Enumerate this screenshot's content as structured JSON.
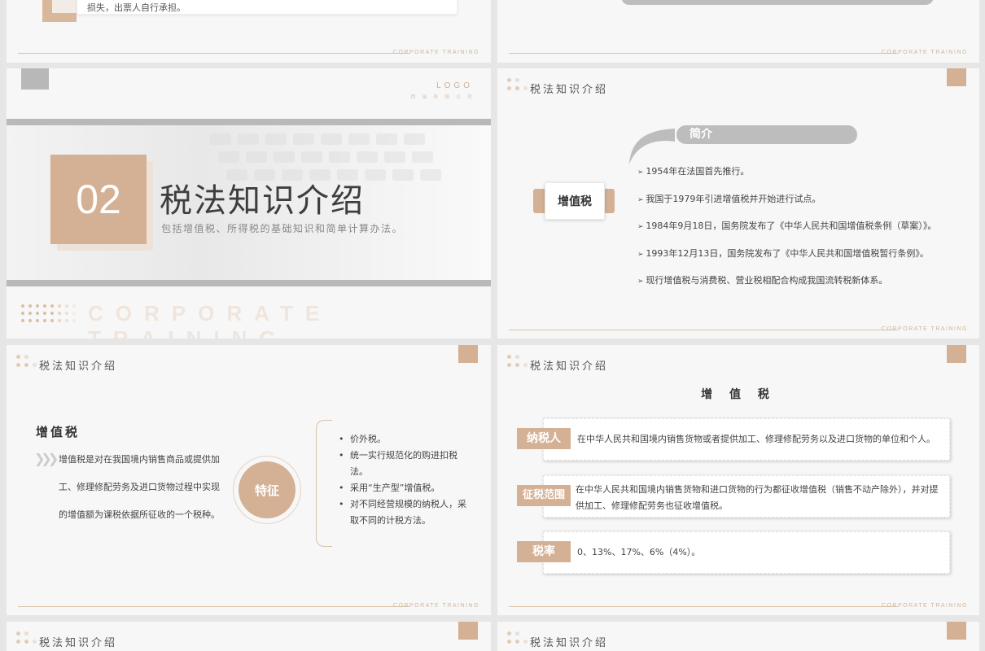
{
  "common": {
    "corporate_training": "CORPORATE TRAINING",
    "header_title": "税法知识介绍"
  },
  "top_left": {
    "text": "损失，出票人自行承担。"
  },
  "cover": {
    "logo": "LOGO",
    "logo_sub": "西 瑞 有 限 公 司",
    "number": "02",
    "title": "税法知识介绍",
    "subtitle": "包括增值税、所得税的基础知识和简单计算办法。",
    "watermark": "CORPORATE TRAINING"
  },
  "intro": {
    "tag": "增值税",
    "heading": "简介",
    "items": [
      "1954年在法国首先推行。",
      "我国于1979年引进增值税并开始进行试点。",
      "1984年9月18日，国务院发布了《中华人民共和国增值税条例（草案）》。",
      "1993年12月13日，国务院发布了《中华人民共和国增值税暂行条例》。",
      "现行增值税与消费税、营业税相配合构成我国流转税新体系。"
    ]
  },
  "features": {
    "heading": "增值税",
    "paragraph": "增值税是对在我国境内销售商品或提供加工、修理修配劳务及进口货物过程中实现的增值额为课税依据所征收的一个税种。",
    "circle_label": "特征",
    "bullets": [
      "价外税。",
      "统一实行规范化的购进扣税法。",
      "采用“生产型”增值税。",
      "对不同经营规模的纳税人，采取不同的计税方法。"
    ]
  },
  "details": {
    "title": "增 值 税",
    "rows": [
      {
        "label": "纳税人",
        "text": "在中华人民共和国境内销售货物或者提供加工、修理修配劳务以及进口货物的单位和个人。"
      },
      {
        "label": "征税范围",
        "text": "在中华人民共和国境内销售货物和进口货物的行为都征收增值税（销售不动产除外），并对提供加工、修理修配劳务也征收增值税。"
      },
      {
        "label": "税率",
        "text": "0、13%、17%、6%（4%）。"
      }
    ]
  },
  "colors": {
    "accent": "#d4b094",
    "gray": "#bdbdbd"
  }
}
